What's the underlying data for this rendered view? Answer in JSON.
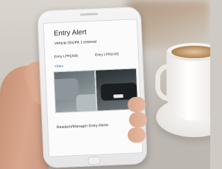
{
  "alert": {
    "title": "Entry Alert",
    "message": "Vehicle 05UPA 1 entered",
    "camera_left": "Entry LPR(268)",
    "camera_right": "Entry LPR(143)",
    "video_link": "Video",
    "footer": "Resident/Manager Entry Alerts"
  }
}
